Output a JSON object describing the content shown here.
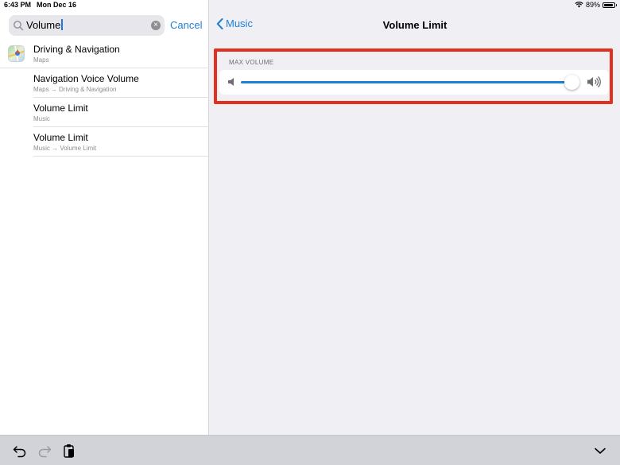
{
  "status_bar": {
    "time": "6:43 PM",
    "date": "Mon Dec 16",
    "battery": "89%",
    "battery_level": 0.89
  },
  "search": {
    "value": "Volume",
    "cancel_label": "Cancel"
  },
  "results": [
    {
      "title": "Driving & Navigation",
      "subtitle": "Maps",
      "icon": "maps-icon"
    },
    {
      "title": "Navigation Voice Volume",
      "subtitle": "Maps → Driving & Navigation"
    },
    {
      "title": "Volume Limit",
      "subtitle": "Music"
    },
    {
      "title": "Volume Limit",
      "subtitle": "Music → Volume Limit"
    }
  ],
  "nav": {
    "back_label": "Music",
    "title": "Volume Limit"
  },
  "settings": {
    "section_header": "MAX VOLUME",
    "max_volume_level": 0.99
  },
  "colors": {
    "accent": "#1f7fd6",
    "highlight": "#e0301e"
  },
  "toolbar": {
    "icons": [
      "undo-icon",
      "redo-icon",
      "paste-icon",
      "chevron-down-icon"
    ]
  }
}
